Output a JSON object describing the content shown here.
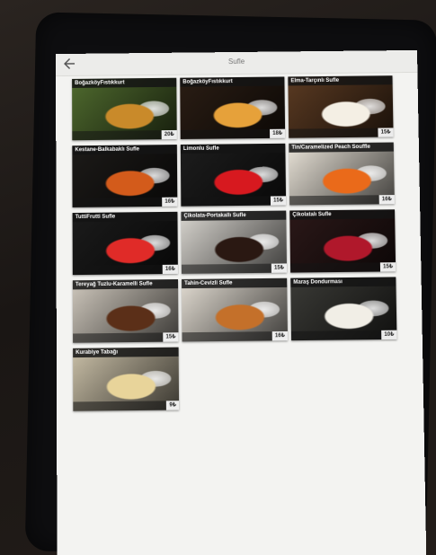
{
  "header": {
    "title": "Sufle"
  },
  "items": [
    {
      "name": "BoğazköyFıstıkkurt",
      "price": "20₺",
      "bg": "#4f6a2e",
      "accent": "#c98a2a"
    },
    {
      "name": "BoğazköyFıstıkkurt",
      "price": "18₺",
      "bg": "#2a1d14",
      "accent": "#e6a13a"
    },
    {
      "name": "Elma-Tarçınlı Sufle",
      "price": "15₺",
      "bg": "#5a3a22",
      "accent": "#f4efe4"
    },
    {
      "name": "Kestane-Balkabaklı Sufle",
      "price": "16₺",
      "bg": "#1c1a18",
      "accent": "#d35b1b"
    },
    {
      "name": "Limonlu Sufle",
      "price": "15₺",
      "bg": "#1d1d1d",
      "accent": "#d7191f"
    },
    {
      "name": "Tin/Caramelized Peach Souffle",
      "price": "16₺",
      "bg": "#e9e3d8",
      "accent": "#ea6a1a"
    },
    {
      "name": "TuttiFrutti Sufle",
      "price": "16₺",
      "bg": "#1b1b1b",
      "accent": "#e02b28"
    },
    {
      "name": "Çikolata-Portakallı Sufle",
      "price": "15₺",
      "bg": "#d9d6d0",
      "accent": "#2a1812"
    },
    {
      "name": "Çikolatalı Sufle",
      "price": "15₺",
      "bg": "#2b1818",
      "accent": "#b0182b"
    },
    {
      "name": "Tereyağ Tuzlu-Karamelli Sufle",
      "price": "15₺",
      "bg": "#cfc8bd",
      "accent": "#5b2f18"
    },
    {
      "name": "Tahin-Cevizli Sufle",
      "price": "16₺",
      "bg": "#e2dcd2",
      "accent": "#c4702a"
    },
    {
      "name": "Maraş Dondurması",
      "price": "10₺",
      "bg": "#3a3a36",
      "accent": "#f1eee6"
    },
    {
      "name": "Kurabiye Tabağı",
      "price": "9₺",
      "bg": "#c9bfa7",
      "accent": "#e8d49a"
    }
  ]
}
